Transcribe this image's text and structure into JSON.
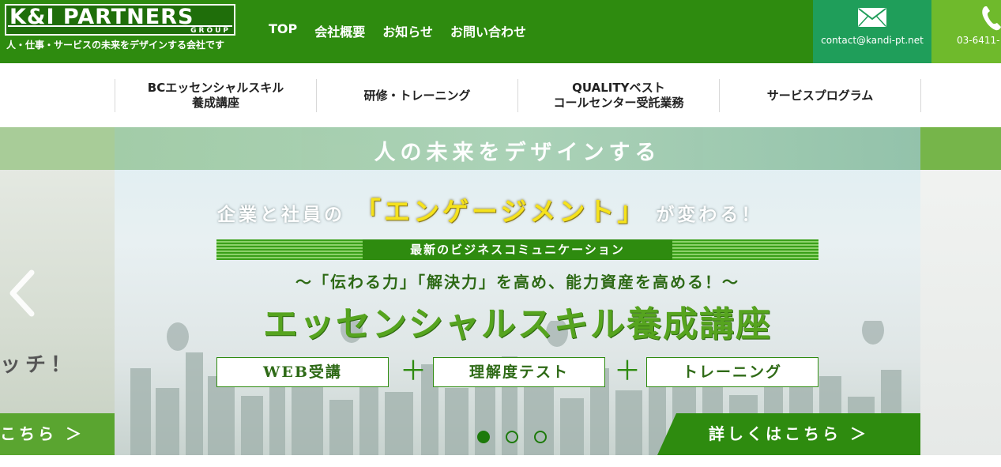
{
  "brand": {
    "logo_text": "K&I PARTNERS",
    "logo_sub": "GROUP",
    "tagline": "人・仕事・サービスの未来をデザインする会社です"
  },
  "top_nav": [
    "TOP",
    "会社概要",
    "お知らせ",
    "お問い合わせ"
  ],
  "contact": {
    "email": "contact@kandi-pt.net",
    "phone": "03-6411-"
  },
  "sub_nav": [
    "BCエッセンシャルスキル\n養成講座",
    "研修・トレーニング",
    "QUALITYベスト\nコールセンター受託業務",
    "サービスプログラム"
  ],
  "hero": {
    "band_text": "人の未来をデザインする",
    "headline_pre": "企業と社員の",
    "headline_hl": "「エンゲージメント」",
    "headline_post": "が変わる！",
    "ribbon": "最新のビジネスコミュニケーション",
    "subtitle": "～「伝わる力」「解決力」を高め、能力資産を高める！～",
    "title": "エッセンシャルスキル養成講座",
    "pills": [
      "WEB受講",
      "理解度テスト",
      "トレーニング"
    ],
    "plus": "＋",
    "cta": "詳しくはこちら ＞",
    "slide_count": 3,
    "active_slide": 1
  },
  "prev_slide": {
    "partial_text": "ッチ！",
    "partial_cta": "こちら ＞"
  },
  "colors": {
    "header_green": "#2e8b0f",
    "mail_bg": "#1f9e5a",
    "phone_bg": "#6fba2c",
    "title_green": "#56a41f",
    "highlight_yellow": "#f5e21c"
  }
}
